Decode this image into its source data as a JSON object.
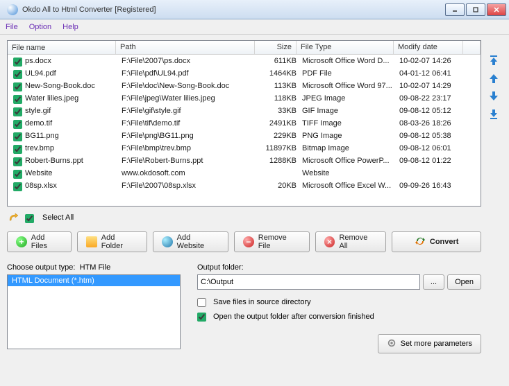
{
  "title": "Okdo All to Html Converter [Registered]",
  "menu": {
    "file": "File",
    "option": "Option",
    "help": "Help"
  },
  "columns": {
    "name": "File name",
    "path": "Path",
    "size": "Size",
    "type": "File Type",
    "date": "Modify date"
  },
  "files": [
    {
      "name": "ps.docx",
      "path": "F:\\File\\2007\\ps.docx",
      "size": "611KB",
      "type": "Microsoft Office Word D...",
      "date": "10-02-07 14:26"
    },
    {
      "name": "UL94.pdf",
      "path": "F:\\File\\pdf\\UL94.pdf",
      "size": "1464KB",
      "type": "PDF File",
      "date": "04-01-12 06:41"
    },
    {
      "name": "New-Song-Book.doc",
      "path": "F:\\File\\doc\\New-Song-Book.doc",
      "size": "113KB",
      "type": "Microsoft Office Word 97...",
      "date": "10-02-07 14:29"
    },
    {
      "name": "Water lilies.jpeg",
      "path": "F:\\File\\jpeg\\Water lilies.jpeg",
      "size": "118KB",
      "type": "JPEG Image",
      "date": "09-08-22 23:17"
    },
    {
      "name": "style.gif",
      "path": "F:\\File\\gif\\style.gif",
      "size": "33KB",
      "type": "GIF Image",
      "date": "09-08-12 05:12"
    },
    {
      "name": "demo.tif",
      "path": "F:\\File\\tif\\demo.tif",
      "size": "2491KB",
      "type": "TIFF Image",
      "date": "08-03-26 18:26"
    },
    {
      "name": "BG11.png",
      "path": "F:\\File\\png\\BG11.png",
      "size": "229KB",
      "type": "PNG Image",
      "date": "09-08-12 05:38"
    },
    {
      "name": "trev.bmp",
      "path": "F:\\File\\bmp\\trev.bmp",
      "size": "11897KB",
      "type": "Bitmap Image",
      "date": "09-08-12 06:01"
    },
    {
      "name": "Robert-Burns.ppt",
      "path": "F:\\File\\Robert-Burns.ppt",
      "size": "1288KB",
      "type": "Microsoft Office PowerP...",
      "date": "09-08-12 01:22"
    },
    {
      "name": "Website",
      "path": "www.okdosoft.com",
      "size": "",
      "type": "Website",
      "date": ""
    },
    {
      "name": "08sp.xlsx",
      "path": "F:\\File\\2007\\08sp.xlsx",
      "size": "20KB",
      "type": "Microsoft Office Excel W...",
      "date": "09-09-26 16:43"
    }
  ],
  "selectAll": "Select All",
  "buttons": {
    "addFiles": "Add Files",
    "addFolder": "Add Folder",
    "addWebsite": "Add Website",
    "removeFile": "Remove File",
    "removeAll": "Remove All",
    "convert": "Convert"
  },
  "outputType": {
    "label": "Choose output type:",
    "current": "HTM File",
    "item": "HTML Document (*.htm)"
  },
  "outputFolder": {
    "label": "Output folder:",
    "path": "C:\\Output",
    "browse": "...",
    "open": "Open",
    "saveInSource": "Save files in source directory",
    "openAfter": "Open the output folder after conversion finished"
  },
  "moreParams": "Set more parameters"
}
